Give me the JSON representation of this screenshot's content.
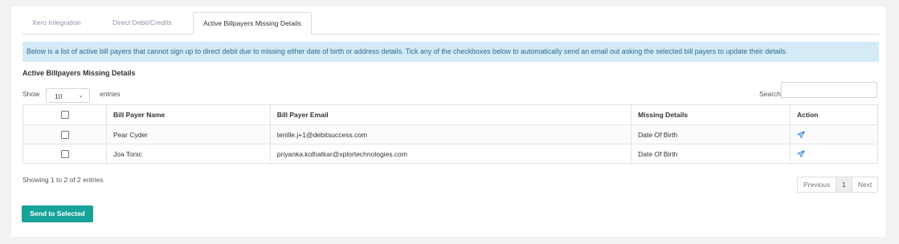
{
  "tabs": [
    {
      "label": "Xero Integration"
    },
    {
      "label": "Direct Debit/Credits"
    },
    {
      "label": "Active Billpayers Missing Details"
    }
  ],
  "info_text": "Below is a list of active bill payers that cannot sign up to direct debit due to missing either date of birth or address details. Tick any of the checkboxes below to automatically send an email out asking the selected bill payers to update their details.",
  "section_title": "Active Billpayers Missing Details",
  "length": {
    "show_label": "Show",
    "value": "10",
    "entries_label": "entries"
  },
  "search": {
    "label": "Search:",
    "value": ""
  },
  "table": {
    "headers": [
      "",
      "Bill Payer Name",
      "Bill Payer Email",
      "Missing Details",
      "Action"
    ],
    "rows": [
      {
        "name": "Pear Cyder",
        "email": "tenille.j+1@debitsuccess.com",
        "missing": "Date Of Birth"
      },
      {
        "name": "Joa Tonic",
        "email": "priyanka.kolhatkar@xplortechnologies.com",
        "missing": "Date Of Birth"
      }
    ]
  },
  "showing_text": "Showing 1 to 2 of 2 entries",
  "pager": {
    "prev": "Previous",
    "page": "1",
    "next": "Next"
  },
  "send_button": "Send to Selected",
  "colors": {
    "accent": "#17a39a",
    "info_bg": "#d4ebf7",
    "info_text": "#2d6a90",
    "icon": "#3b7fd1"
  },
  "icons": {
    "action": "send-icon"
  }
}
